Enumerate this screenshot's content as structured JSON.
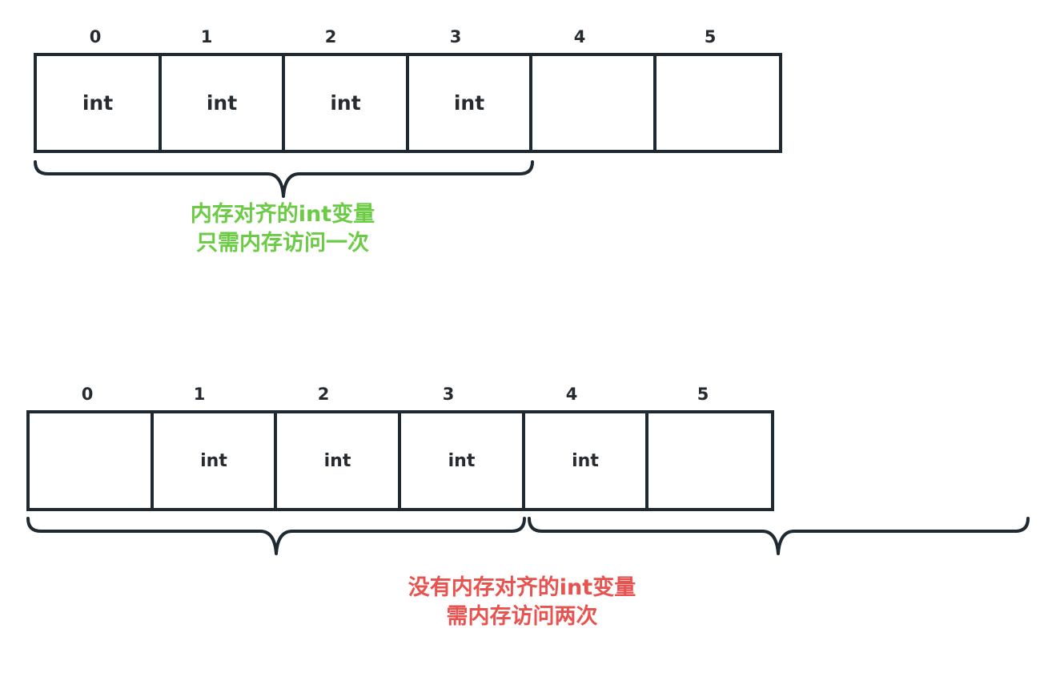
{
  "colors": {
    "stroke": "#1e2932",
    "text": "#262b30",
    "aligned_caption": "#6ccb45",
    "unaligned_caption": "#e8524f"
  },
  "aligned": {
    "indices": [
      "0",
      "1",
      "2",
      "3",
      "4",
      "5"
    ],
    "cells": [
      "int",
      "int",
      "int",
      "int",
      "",
      ""
    ],
    "caption_line1": "内存对齐的int变量",
    "caption_line2": "只需内存访问一次"
  },
  "unaligned": {
    "indices": [
      "0",
      "1",
      "2",
      "3",
      "4",
      "5"
    ],
    "cells": [
      "",
      "int",
      "int",
      "int",
      "int",
      ""
    ],
    "caption_line1": "没有内存对齐的int变量",
    "caption_line2": "需内存访问两次"
  }
}
